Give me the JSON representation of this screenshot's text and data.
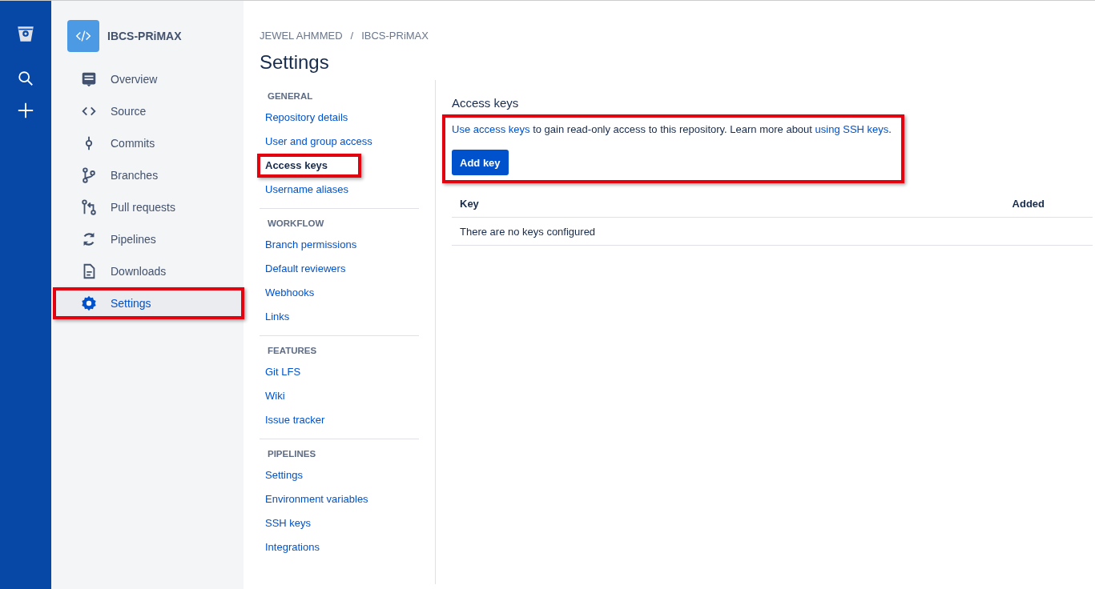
{
  "repository": {
    "name": "IBCS-PRiMAX"
  },
  "sidebar": {
    "items": [
      {
        "label": "Overview",
        "selected": false,
        "highlighted": false
      },
      {
        "label": "Source",
        "selected": false,
        "highlighted": false
      },
      {
        "label": "Commits",
        "selected": false,
        "highlighted": false
      },
      {
        "label": "Branches",
        "selected": false,
        "highlighted": false
      },
      {
        "label": "Pull requests",
        "selected": false,
        "highlighted": false
      },
      {
        "label": "Pipelines",
        "selected": false,
        "highlighted": false
      },
      {
        "label": "Downloads",
        "selected": false,
        "highlighted": false
      },
      {
        "label": "Settings",
        "selected": true,
        "highlighted": true
      }
    ]
  },
  "breadcrumb": [
    "JEWEL AHMMED",
    "/",
    "IBCS-PRiMAX"
  ],
  "page_title": "Settings",
  "settings_nav": [
    {
      "heading": "GENERAL",
      "items": [
        {
          "label": "Repository details",
          "selected": false,
          "highlighted": false
        },
        {
          "label": "User and group access",
          "selected": false,
          "highlighted": false
        },
        {
          "label": "Access keys",
          "selected": true,
          "highlighted": true
        },
        {
          "label": "Username aliases",
          "selected": false,
          "highlighted": false
        }
      ]
    },
    {
      "heading": "WORKFLOW",
      "items": [
        {
          "label": "Branch permissions",
          "selected": false,
          "highlighted": false
        },
        {
          "label": "Default reviewers",
          "selected": false,
          "highlighted": false
        },
        {
          "label": "Webhooks",
          "selected": false,
          "highlighted": false
        },
        {
          "label": "Links",
          "selected": false,
          "highlighted": false
        }
      ]
    },
    {
      "heading": "FEATURES",
      "items": [
        {
          "label": "Git LFS",
          "selected": false,
          "highlighted": false
        },
        {
          "label": "Wiki",
          "selected": false,
          "highlighted": false
        },
        {
          "label": "Issue tracker",
          "selected": false,
          "highlighted": false
        }
      ]
    },
    {
      "heading": "PIPELINES",
      "items": [
        {
          "label": "Settings",
          "selected": false,
          "highlighted": false
        },
        {
          "label": "Environment variables",
          "selected": false,
          "highlighted": false
        },
        {
          "label": "SSH keys",
          "selected": false,
          "highlighted": false
        },
        {
          "label": "Integrations",
          "selected": false,
          "highlighted": false
        }
      ]
    }
  ],
  "content": {
    "heading": "Access keys",
    "highlighted": true,
    "intro": [
      {
        "text": "Use access keys",
        "link": true
      },
      {
        "text": " to gain read-only access to this repository. Learn more about ",
        "link": false
      },
      {
        "text": "using SSH keys",
        "link": true
      },
      {
        "text": ".",
        "link": false
      }
    ],
    "button": "Add key",
    "table": {
      "columns": [
        "Key",
        "Added"
      ],
      "empty_message": "There are no keys configured"
    }
  }
}
